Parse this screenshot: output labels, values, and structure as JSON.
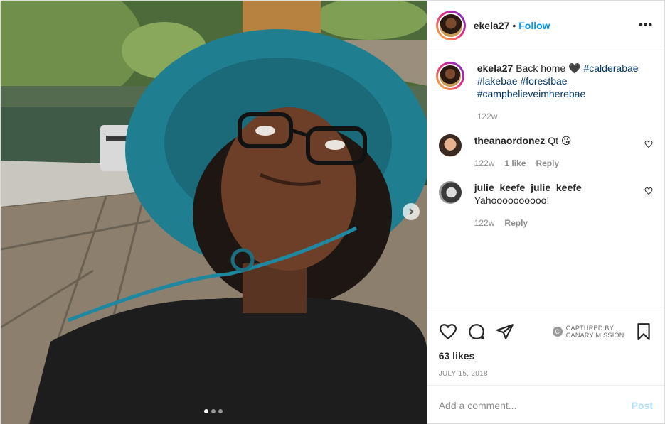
{
  "header": {
    "username": "ekela27",
    "separator": "•",
    "follow_label": "Follow",
    "more_label": "•••"
  },
  "caption": {
    "username": "ekela27",
    "text": "Back home",
    "heart": "🖤",
    "hashtags": [
      "#calderabae",
      "#lakebae",
      "#forestbae",
      "#campbelieveimherebae"
    ],
    "age": "122w"
  },
  "comments": [
    {
      "username": "theanaordonez",
      "text": "Qt",
      "emoji": "😘",
      "age": "122w",
      "likes": "1 like",
      "reply": "Reply"
    },
    {
      "username": "julie_keefe_julie_keefe",
      "text": "Yahoooooooooo!",
      "age": "122w",
      "reply": "Reply"
    }
  ],
  "actions": {
    "captured_line1": "CAPTURED BY",
    "captured_line2": "CANARY MISSION",
    "captured_badge": "C",
    "likes": "63 likes",
    "date": "JULY 15, 2018"
  },
  "composer": {
    "placeholder": "Add a comment...",
    "post_label": "Post"
  },
  "carousel": {
    "current": 1,
    "total": 3
  },
  "colors": {
    "link": "#0095f6",
    "hashtag": "#00376b",
    "hat": "#1f7f91"
  }
}
